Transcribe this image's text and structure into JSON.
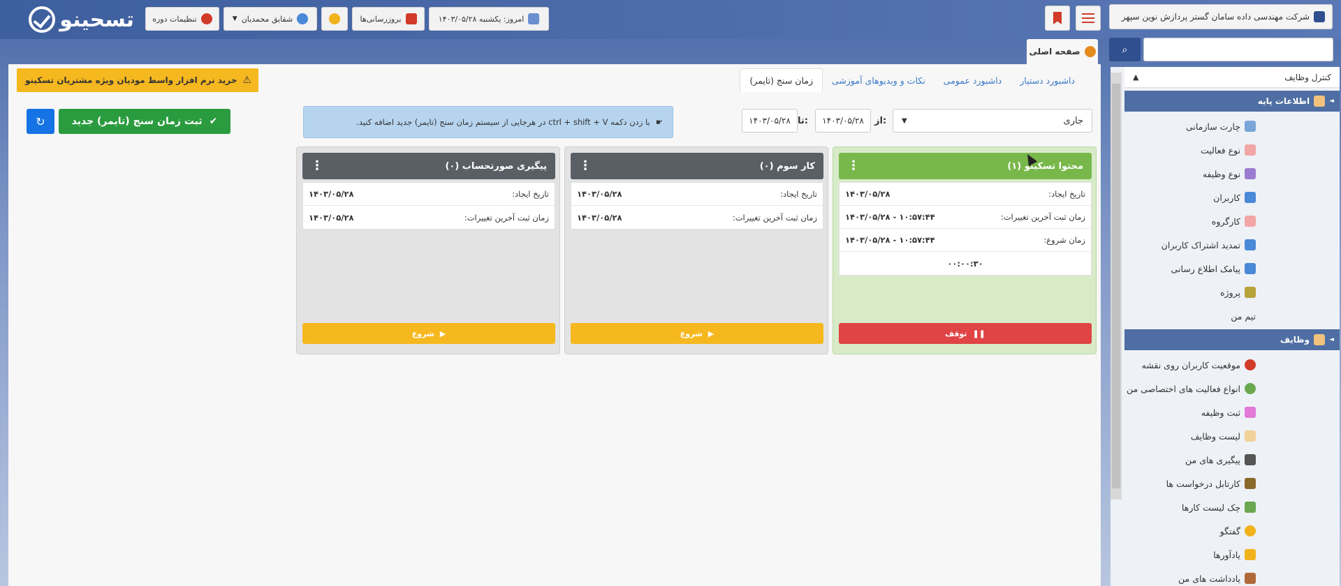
{
  "brand": {
    "logo_text": "تسحینو"
  },
  "header": {
    "course_settings": "تنظیمات دوره",
    "user_name": "شقایق محمدیان",
    "updates": "بروزرسانی‌ها",
    "today_label": "امروز: یکشنبه ۱۴۰۳/۰۵/۲۸",
    "company_name": "شرکت مهندسی داده سامان گستر پردازش نوین سپهر"
  },
  "page_tab": "صفحه اصلی",
  "tabs": [
    "داشبورد دستیار",
    "داشبورد عمومی",
    "نکات و ویدیوهای آموزشی",
    "زمان سنج (تایمر)"
  ],
  "promo": "خرید نرم افزار واسط مودیان ویژه مشتریان تسکینو",
  "filters": {
    "status_value": "جاری",
    "from_label": "از:",
    "from_value": "۱۴۰۳/۰۵/۲۸",
    "to_label": "تا:",
    "to_value": "۱۴۰۳/۰۵/۲۸"
  },
  "info_text": "با زدن دکمه ctrl + shift + V در هرجایی از سیستم زمان سنج (تایمر) جدید اضافه کنید.",
  "new_timer_button": "ثبت زمان سنج (تایمر) جدید",
  "columns": [
    {
      "title": "محتوا تسکینو (۱)",
      "color": "#78b84a",
      "rows": [
        {
          "label": "تاریخ ایجاد:",
          "value": "۱۴۰۳/۰۵/۲۸"
        },
        {
          "label": "زمان ثبت آخرین تغییرات:",
          "value": "۱۴۰۳/۰۵/۲۸ - ۱۰:۵۷:۴۴"
        },
        {
          "label": "زمان شروع:",
          "value": "۱۴۰۳/۰۵/۲۸ - ۱۰:۵۷:۴۴"
        }
      ],
      "elapsed": "۰۰:۰۰:۳۰",
      "button": "توقف",
      "button_color": "#e04444"
    },
    {
      "title": "کار سوم (۰)",
      "color": "#5a5f66",
      "rows": [
        {
          "label": "تاریخ ایجاد:",
          "value": "۱۴۰۳/۰۵/۲۸"
        },
        {
          "label": "زمان ثبت آخرین تغییرات:",
          "value": "۱۴۰۳/۰۵/۲۸"
        }
      ],
      "button": "شروع",
      "button_color": "#f6b81f"
    },
    {
      "title": "پیگیری صورتحساب (۰)",
      "color": "#5a5f66",
      "rows": [
        {
          "label": "تاریخ ایجاد:",
          "value": "۱۴۰۳/۰۵/۲۸"
        },
        {
          "label": "زمان ثبت آخرین تغییرات:",
          "value": "۱۴۰۳/۰۵/۲۸"
        }
      ],
      "button": "شروع",
      "button_color": "#f6b81f"
    }
  ],
  "sidebar": {
    "header": "کنترل وظایف",
    "group1": "اطلاعات پایه",
    "group1_items": [
      "چارت سازمانی",
      "نوع فعالیت",
      "نوع وظیفه",
      "کاربران",
      "کارگروه",
      "تمدید اشتراک کاربران",
      "پیامک اطلاع رسانی",
      "پروژه",
      "تیم من"
    ],
    "group2": "وظایف",
    "group2_items": [
      "موقعیت کاربران روی نقشه",
      "انواع فعالیت های اختصاصی من",
      "ثبت وظیفه",
      "لیست وظایف",
      "پیگیری های من",
      "کارتابل درخواست ها",
      "چک لیست کارها",
      "گفتگو",
      "یادآورها",
      "یادداشت های من"
    ]
  }
}
